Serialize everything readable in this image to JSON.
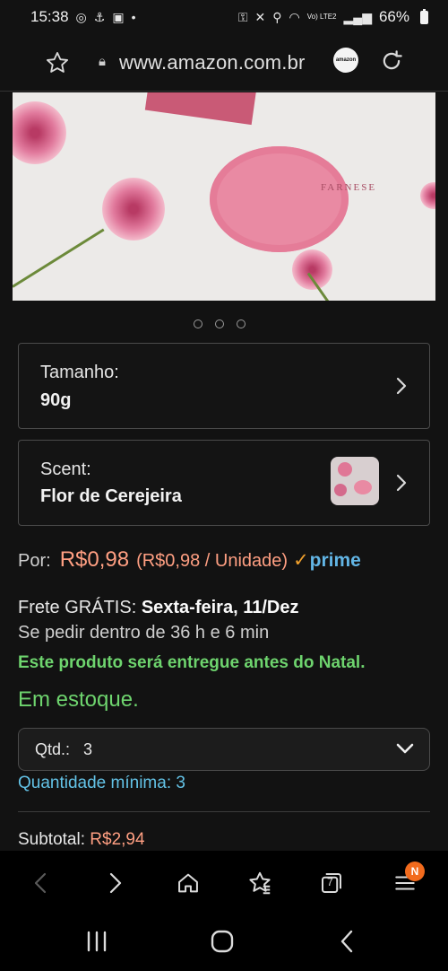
{
  "status_bar": {
    "time": "15:38",
    "network_label": "Vo) LTE2",
    "battery": "66%"
  },
  "url_bar": {
    "url": "www.amazon.com.br",
    "badge_text": "amazon"
  },
  "product_image": {
    "soap_text": "FARNESE",
    "carousel_total": 3
  },
  "options": {
    "size": {
      "label": "Tamanho:",
      "value": "90g"
    },
    "scent": {
      "label": "Scent:",
      "value": "Flor de Cerejeira"
    }
  },
  "price": {
    "prefix": "Por:",
    "amount": "R$0,98",
    "unit": "(R$0,98 / Unidade)",
    "prime_check": "✓",
    "prime": "prime"
  },
  "delivery": {
    "frete_prefix": "Frete GRÁTIS:",
    "frete_date": "Sexta-feira, 11/Dez",
    "order_within": "Se pedir dentro de 36 h e 6 min",
    "christmas": "Este produto será entregue antes do Natal."
  },
  "stock": "Em estoque.",
  "quantity": {
    "label": "Qtd.:",
    "value": "3",
    "minimum": "Quantidade mínima: 3"
  },
  "subtotal": {
    "label": "Subtotal:",
    "amount": "R$2,94"
  },
  "browser_nav": {
    "tabs_count": "7",
    "notification_badge": "N"
  },
  "colors": {
    "background": "#121212",
    "price": "#ff9f82",
    "prime": "#62b5e5",
    "stock_green": "#6ed46e",
    "link_blue": "#63c2e6",
    "notification": "#f26b1d"
  }
}
